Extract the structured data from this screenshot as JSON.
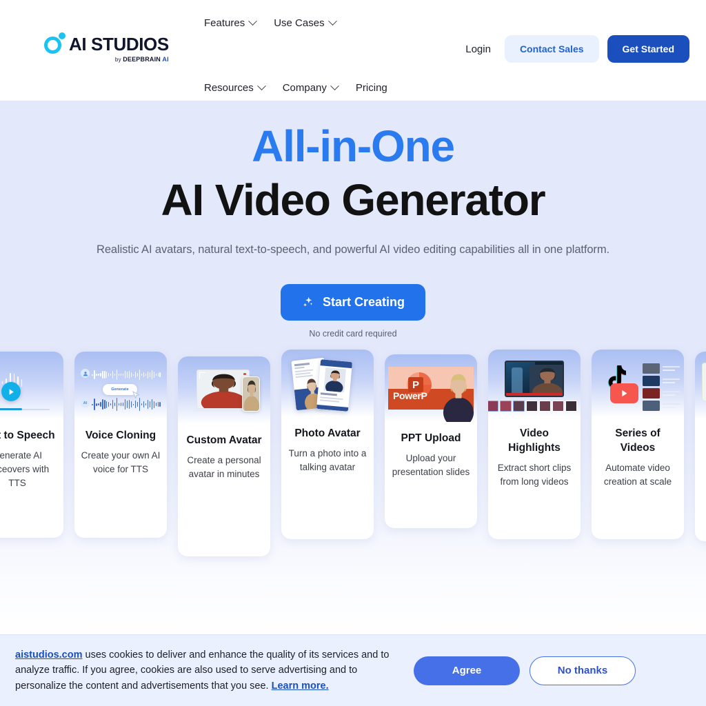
{
  "header": {
    "logo": {
      "name": "AI STUDIOS",
      "tagline_by": "by ",
      "tagline_brand": "DEEPBRAIN ",
      "tagline_accent": "AI"
    },
    "nav": [
      {
        "label": "Features",
        "has_dropdown": true
      },
      {
        "label": "Use Cases",
        "has_dropdown": true
      },
      {
        "label": "Resources",
        "has_dropdown": true
      },
      {
        "label": "Company",
        "has_dropdown": true
      },
      {
        "label": "Pricing",
        "has_dropdown": false
      }
    ],
    "login_label": "Login",
    "contact_sales_label": "Contact Sales",
    "get_started_label": "Get Started"
  },
  "hero": {
    "headline_accent": "All-in-One",
    "headline_main": "AI Video Generator",
    "subheadline": "Realistic AI avatars, natural text-to-speech, and powerful AI video editing capabilities all in one platform.",
    "cta_label": "Start Creating",
    "cta_icon": "sparkle-icon",
    "cta_note": "No credit card required"
  },
  "carousel": {
    "cards": [
      {
        "title": "Text to Speech",
        "desc": "Generate AI voiceovers with TTS",
        "art": "tts"
      },
      {
        "title": "Voice Cloning",
        "desc": "Create your own AI voice for TTS",
        "art": "voice"
      },
      {
        "title": "Custom Avatar",
        "desc": "Create a personal avatar in minutes",
        "art": "avatar"
      },
      {
        "title": "Photo Avatar",
        "desc": "Turn a photo into a talking avatar",
        "art": "photo"
      },
      {
        "title": "PPT Upload",
        "desc": "Upload your presentation slides",
        "art": "ppt"
      },
      {
        "title": "Video Highlights",
        "desc": "Extract short clips from long videos",
        "art": "highlights"
      },
      {
        "title": "Series of Videos",
        "desc": "Automate video creation at scale",
        "art": "series"
      },
      {
        "title": "",
        "desc": "",
        "art": "partial"
      }
    ],
    "ppt_label": "PowerPoint",
    "generate_label": "Generate"
  },
  "cookie_banner": {
    "domain": "aistudios.com",
    "text_part1": " uses cookies to deliver and enhance the quality of its services and to analyze traffic. If you agree, cookies are also used to serve advertising and to personalize the content and advertisements that you see. ",
    "learn_more": "Learn more.",
    "agree_label": "Agree",
    "decline_label": "No thanks"
  },
  "colors": {
    "brand_cyan": "#1ec2ef",
    "brand_navy": "#1a4fbd",
    "accent_blue": "#2a7bf0",
    "cta_blue": "#2272eb",
    "hero_bg": "#e3e8fb",
    "cookie_bg": "#eaf0fd",
    "cookie_btn": "#4570e8"
  }
}
